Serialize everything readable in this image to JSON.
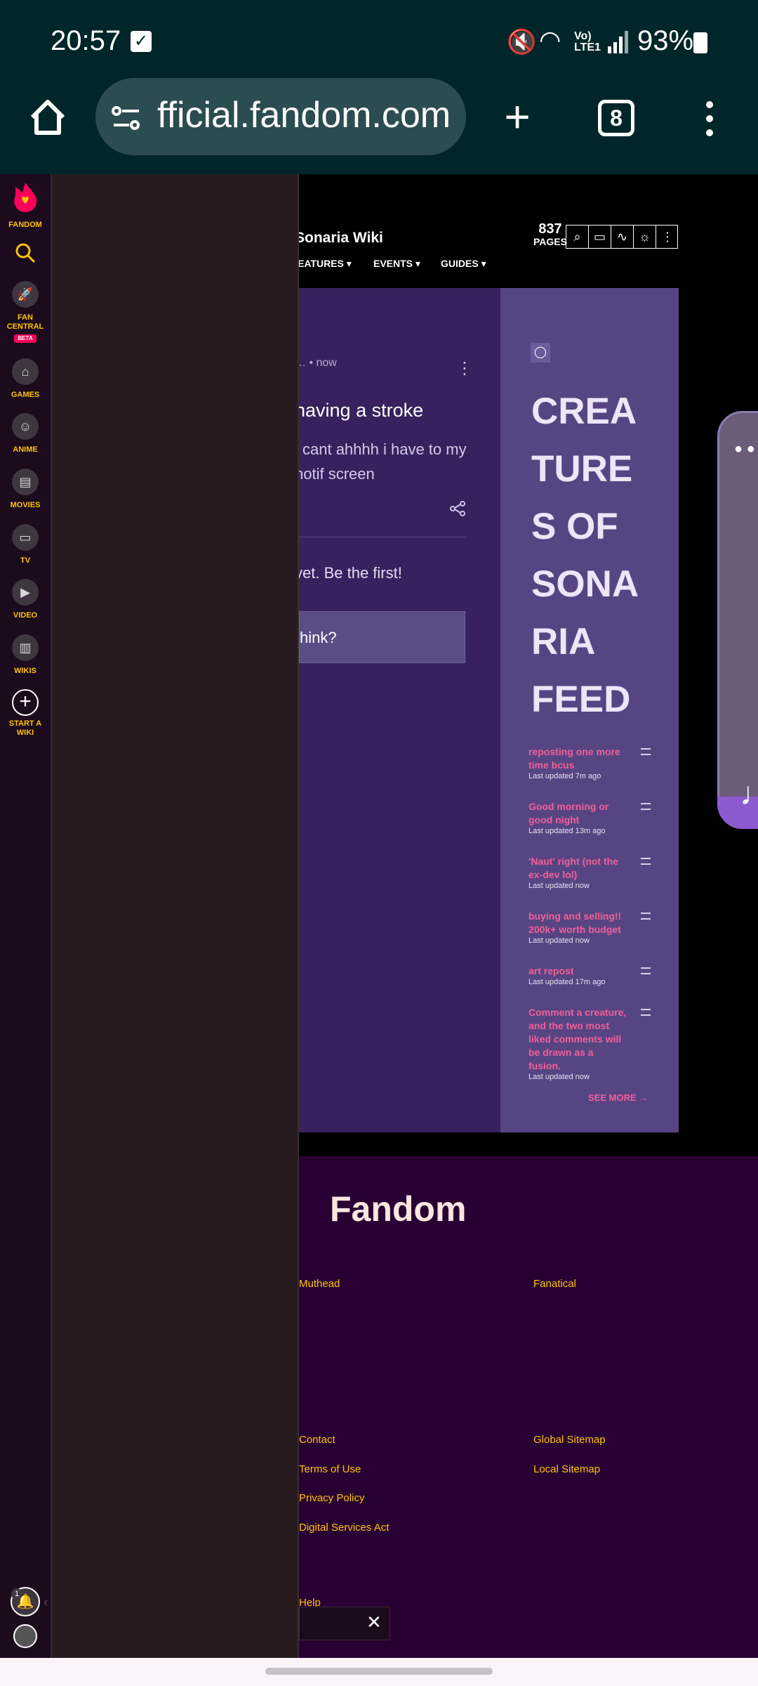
{
  "status": {
    "time": "20:57",
    "battery": "93%"
  },
  "browser": {
    "url": "fficial.fandom.com",
    "tab_count": "8"
  },
  "wiki": {
    "title": "Sonaria Wiki",
    "pages_count": "837",
    "pages_label": "PAGES",
    "nav": [
      "EATURES",
      "EVENTS",
      "GUIDES"
    ]
  },
  "discussion": {
    "meta": "…  •  now",
    "title": "having a stroke",
    "body": "i cant ahhhh i have to my notif screen",
    "empty_note": "yet. Be the first!",
    "input_placeholder": "hink?"
  },
  "feed": {
    "title": "CREATURES OF SONARIA FEED",
    "title_lines": [
      "CREA",
      "TURE",
      "S OF",
      "SONA",
      "RIA",
      "FEED"
    ],
    "items": [
      {
        "title": "reposting one more time bcus",
        "time": "Last updated 7m ago"
      },
      {
        "title": "Good morning or good night",
        "time": "Last updated 13m ago"
      },
      {
        "title": "'Naut' right (not the ex-dev lol)",
        "time": "Last updated now"
      },
      {
        "title": "buying and selling!! 200k+ worth budget",
        "time": "Last updated now"
      },
      {
        "title": "art repost",
        "time": "Last updated 17m ago"
      },
      {
        "title": "Comment a creature, and the two most liked comments will be drawn as a fusion.",
        "time": "Last updated now"
      }
    ],
    "see_more": "SEE MORE"
  },
  "footer": {
    "logo": "Fandom",
    "links_left_top": [
      "Muthead"
    ],
    "links_right_top": [
      "Fanatical"
    ],
    "links_left": [
      "Contact",
      "Terms of Use",
      "Privacy Policy",
      "Digital Services Act"
    ],
    "links_right": [
      "Global Sitemap",
      "Local Sitemap"
    ],
    "help": "Help"
  },
  "rail": {
    "items": [
      {
        "label": "FANDOM",
        "icon": "fandom-flame-icon"
      },
      {
        "label": "",
        "icon": "search-icon"
      },
      {
        "label": "FAN CENTRAL",
        "badge": "BETA",
        "icon": "rocket-icon"
      },
      {
        "label": "GAMES",
        "icon": "gamepad-icon"
      },
      {
        "label": "ANIME",
        "icon": "anime-face-icon"
      },
      {
        "label": "MOVIES",
        "icon": "clapper-icon"
      },
      {
        "label": "TV",
        "icon": "tv-icon"
      },
      {
        "label": "VIDEO",
        "icon": "play-icon"
      },
      {
        "label": "WIKIS",
        "icon": "book-icon"
      },
      {
        "label": "START A WIKI",
        "icon": "plus-circle-icon"
      }
    ],
    "notification_count": "1"
  },
  "colors": {
    "accent_yellow": "#ffc500",
    "feed_link": "#f15f97",
    "discussion_bg": "#38215e",
    "feed_bg": "#574583",
    "footer_bg": "#290033"
  }
}
